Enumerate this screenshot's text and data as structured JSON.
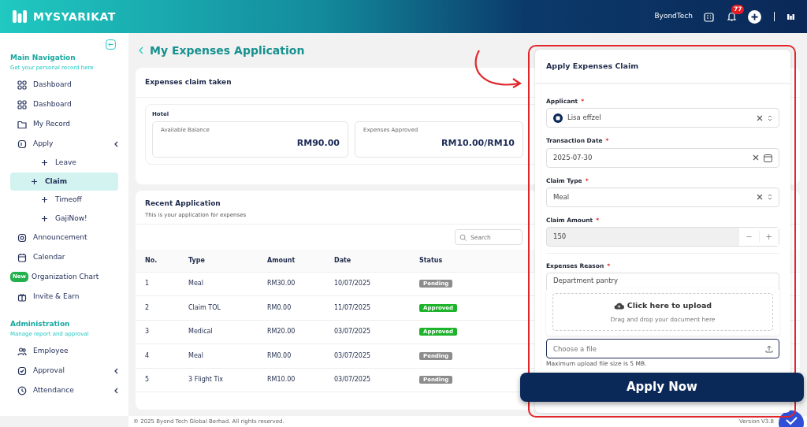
{
  "header": {
    "brand": "MYSYARIKAT",
    "company": "ByondTech",
    "notification_count": "77"
  },
  "sidebar": {
    "sections": [
      {
        "title": "Main Navigation",
        "subtitle": "Get your personal record here",
        "items": [
          {
            "label": "Dashboard"
          },
          {
            "label": "Dashboard"
          },
          {
            "label": "My Record"
          },
          {
            "label": "Apply",
            "has_submenu": true,
            "children": [
              {
                "label": "Leave",
                "selected": false
              },
              {
                "label": "Claim",
                "selected": true
              },
              {
                "label": "Timeoff",
                "selected": false
              },
              {
                "label": "GajiNow!",
                "selected": false
              }
            ]
          },
          {
            "label": "Announcement"
          },
          {
            "label": "Calendar"
          },
          {
            "label": "Organization Chart",
            "badge": "New"
          },
          {
            "label": "Invite & Earn"
          }
        ]
      },
      {
        "title": "Administration",
        "subtitle": "Manage report and approval",
        "items": [
          {
            "label": "Employee"
          },
          {
            "label": "Approval",
            "has_submenu": true
          },
          {
            "label": "Attendance",
            "has_submenu": true
          }
        ]
      }
    ]
  },
  "page": {
    "title": "My Expenses Application"
  },
  "claim_card": {
    "title": "Expenses claim taken",
    "group": "Hotel",
    "stats": [
      {
        "label": "Available Balance",
        "value": "RM90.00"
      },
      {
        "label": "Expenses Approved",
        "value": "RM10.00/RM10"
      }
    ]
  },
  "recent": {
    "title": "Recent Application",
    "subtitle": "This is your application for expenses",
    "search": {
      "placeholder": "Search"
    },
    "columns": [
      "No.",
      "Type",
      "Amount",
      "Date",
      "Status"
    ],
    "rows": [
      {
        "no": "1",
        "type": "Meal",
        "amount": "RM30.00",
        "date": "10/07/2025",
        "status": "Pending",
        "kind": "pending"
      },
      {
        "no": "2",
        "type": "Claim TOL",
        "amount": "RM0.00",
        "date": "11/07/2025",
        "status": "Approved",
        "kind": "approved"
      },
      {
        "no": "3",
        "type": "Medical",
        "amount": "RM20.00",
        "date": "03/07/2025",
        "status": "Approved",
        "kind": "approved"
      },
      {
        "no": "4",
        "type": "Meal",
        "amount": "RM0.00",
        "date": "03/07/2025",
        "status": "Pending",
        "kind": "pending"
      },
      {
        "no": "5",
        "type": "3 Flight Tix",
        "amount": "RM10.00",
        "date": "03/07/2025",
        "status": "Pending",
        "kind": "pending"
      }
    ]
  },
  "panel": {
    "title": "Apply Expenses Claim",
    "fields": [
      {
        "label": "Applicant",
        "required_mark": "*",
        "kind": "select",
        "value": "Lisa effzel",
        "avatar": true
      },
      {
        "label": "Transaction Date",
        "required_mark": "*",
        "kind": "date",
        "value": "2025-07-30"
      },
      {
        "label": "Claim Type",
        "required_mark": "*",
        "kind": "select",
        "value": "Meal"
      },
      {
        "label": "Claim Amount",
        "required_mark": "*",
        "kind": "number",
        "value": "150",
        "disabled": true,
        "stepper": [
          "−",
          "+"
        ]
      },
      {
        "label": "Expenses Reason",
        "required_mark": "*",
        "kind": "textarea",
        "value": "Department pantry"
      }
    ],
    "upload": {
      "title": "Click here to upload",
      "hint": "Drag and drop your document here"
    },
    "file": {
      "placeholder": "Choose a file",
      "hint": "Maximum upload file size is 5 MB."
    },
    "button": "Apply Now"
  },
  "footer": {
    "copyright": "© 2025 Byond Tech Global Berhad. All rights reserved.",
    "version": "Version V3.8"
  }
}
